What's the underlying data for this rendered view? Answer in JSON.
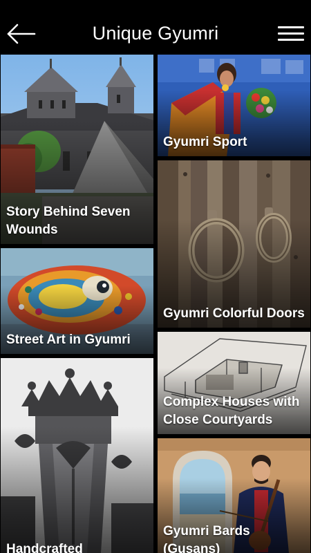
{
  "header": {
    "title": "Unique Gyumri",
    "back_icon": "back-arrow-icon",
    "menu_icon": "hamburger-menu-icon"
  },
  "tiles": [
    {
      "label": "Story Behind Seven Wounds"
    },
    {
      "label": "Gyumri Sport"
    },
    {
      "label": "Gyumri Colorful Doors"
    },
    {
      "label": "Street Art in Gyumri"
    },
    {
      "label": "Complex Houses with Close Courtyards"
    },
    {
      "label": "Handcrafted"
    },
    {
      "label": "Gyumri Bards (Gusans)"
    }
  ],
  "colors": {
    "background": "#000000",
    "header_text": "#ffffff",
    "tile_text": "#ffffff"
  }
}
